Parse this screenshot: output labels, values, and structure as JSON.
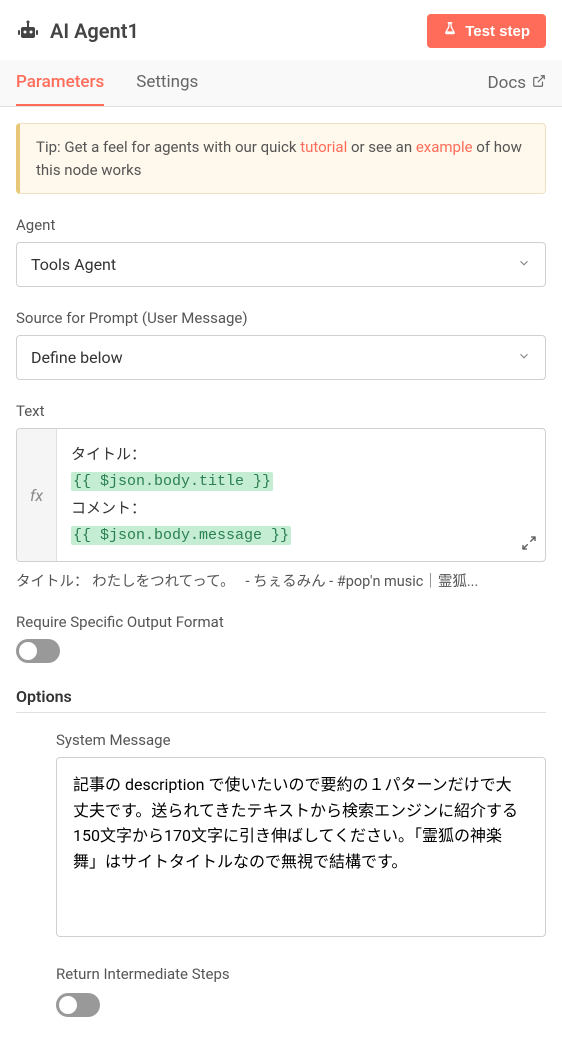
{
  "header": {
    "title": "AI Agent1",
    "test_button": "Test step"
  },
  "tabs": {
    "parameters": "Parameters",
    "settings": "Settings",
    "docs": "Docs"
  },
  "tip": {
    "prefix": "Tip: Get a feel for agents with our quick ",
    "tutorial": "tutorial",
    "mid": " or see an ",
    "example": "example",
    "suffix": " of how this node works"
  },
  "fields": {
    "agent_label": "Agent",
    "agent_value": "Tools Agent",
    "source_label": "Source for Prompt (User Message)",
    "source_value": "Define below",
    "text_label": "Text",
    "text_line1": "タイトル：",
    "text_expr1": "{{ $json.body.title }}",
    "text_line2": "コメント：",
    "text_expr2": "{{ $json.body.message }}",
    "preview": "タイトル： わたしをつれてって。　 - ちぇるみん - #pop'n music｜霊狐...",
    "require_label": "Require Specific Output Format"
  },
  "options": {
    "title": "Options",
    "system_message_label": "System Message",
    "system_message_value": "記事の description で使いたいので要約の１パターンだけで大丈夫です。送られてきたテキストから検索エンジンに紹介する150文字から170文字に引き伸ばしてください。「霊狐の神楽舞」はサイトタイトルなので無視で結構です。",
    "intermediate_label": "Return Intermediate Steps"
  },
  "fx_label": "fx"
}
